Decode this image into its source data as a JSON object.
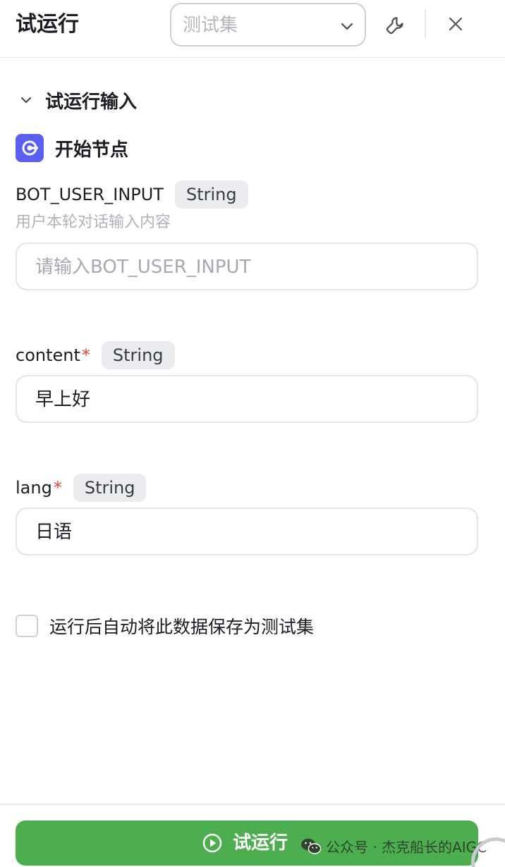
{
  "header": {
    "title": "试运行",
    "testset_select": {
      "placeholder": "测试集",
      "icon": "chevron-down-icon"
    },
    "tool_icon": "wrench-icon",
    "close_icon": "close-icon"
  },
  "section": {
    "title": "试运行输入",
    "icon": "chevron-down-icon"
  },
  "node": {
    "title": "开始节点",
    "icon": "start-node-icon",
    "icon_color": "#5b5ff0"
  },
  "fields": [
    {
      "name": "BOT_USER_INPUT",
      "required": false,
      "type": "String",
      "description": "用户本轮对话输入内容",
      "placeholder": "请输入BOT_USER_INPUT",
      "value": ""
    },
    {
      "name": "content",
      "required": true,
      "required_mark": "*",
      "type": "String",
      "value": "早上好"
    },
    {
      "name": "lang",
      "required": true,
      "required_mark": "*",
      "type": "String",
      "value": "日语"
    }
  ],
  "save_option": {
    "label": "运行后自动将此数据保存为测试集",
    "checked": false
  },
  "run_button": {
    "label": "试运行",
    "icon": "play-circle-icon",
    "color": "#4cae4f"
  },
  "watermark": {
    "text": "公众号 · 杰克船长的AIGC",
    "icon": "wechat-icon"
  }
}
